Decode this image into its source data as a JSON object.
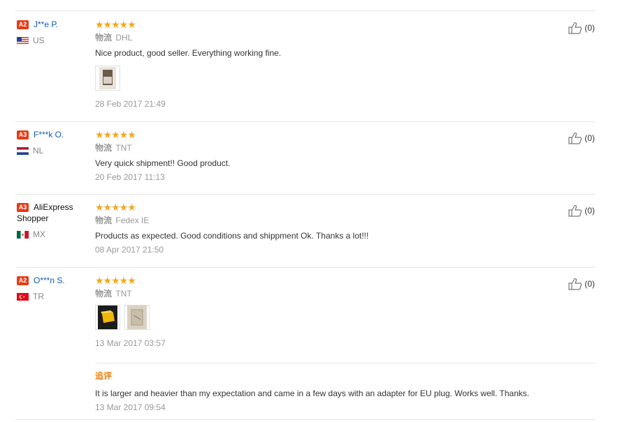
{
  "reviews": [
    {
      "level": "A2",
      "name": "J**e P.",
      "country": "US",
      "rating": 5,
      "shipping_label": "物流",
      "shipping": "DHL",
      "text": "Nice product, good seller. Everything working fine.",
      "images": 1,
      "date": "28 Feb 2017 21:49",
      "likes": "(0)"
    },
    {
      "level": "A3",
      "name": "F***k O.",
      "country": "NL",
      "rating": 5,
      "shipping_label": "物流",
      "shipping": "TNT",
      "text": "Very quick shipment!! Good product.",
      "images": 0,
      "date": "20 Feb 2017 11:13",
      "likes": "(0)"
    },
    {
      "level": "A3",
      "name": "AliExpress Shopper",
      "name_line1": "AliExpress",
      "name_line2": "Shopper",
      "country": "MX",
      "rating": 5,
      "shipping_label": "物流",
      "shipping": "Fedex IE",
      "text": "Products as expected. Good conditions and shippment Ok. Thanks a lot!!!",
      "images": 0,
      "date": "08 Apr 2017 21:50",
      "likes": "(0)"
    },
    {
      "level": "A2",
      "name": "O***n S.",
      "country": "TR",
      "rating": 5,
      "shipping_label": "物流",
      "shipping": "TNT",
      "text": "",
      "images": 2,
      "date": "13 Mar 2017 03:57",
      "likes": "(0)",
      "followup": {
        "title": "追评",
        "text": "It is larger and heavier than my expectation and came in a few days with an adapter for EU plug. Works well. Thanks.",
        "date": "13 Mar 2017 09:54"
      }
    }
  ],
  "colors": {
    "accent_star": "#f5a623",
    "name_link": "#0e5dad",
    "level_badge": "#e63c17",
    "followup_title": "#e97f0e"
  },
  "icons": {
    "like": "thumbs-up-icon",
    "star": "star-icon"
  }
}
